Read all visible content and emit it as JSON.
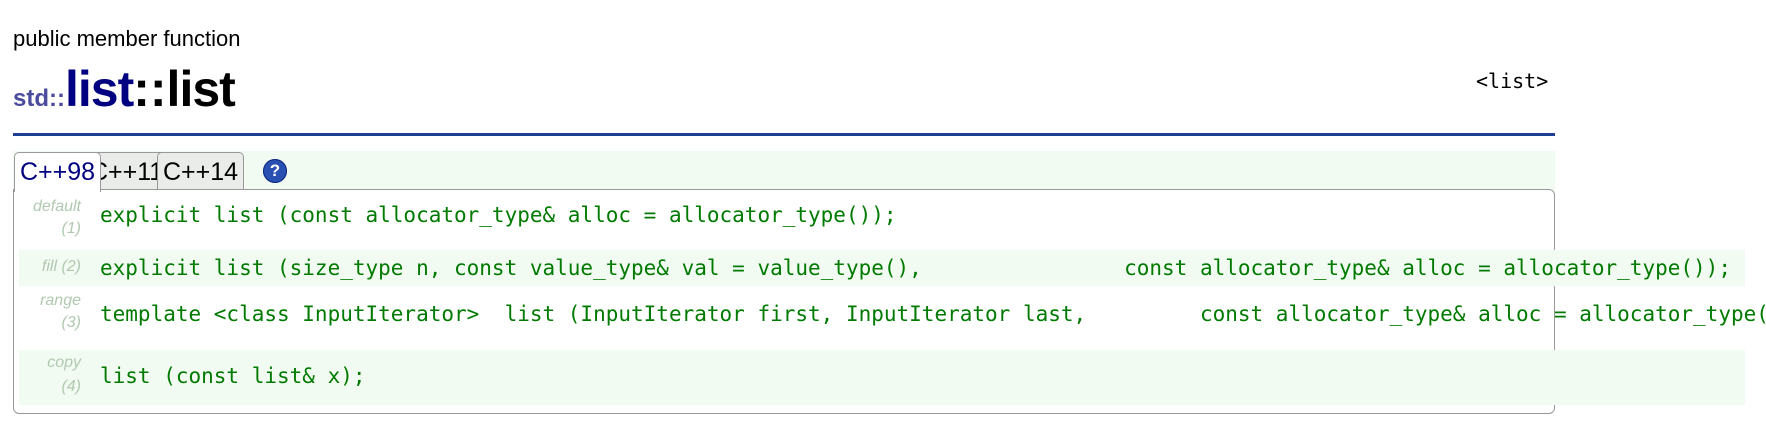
{
  "header": {
    "kind": "public member function",
    "namespace": "std::",
    "class_name": "list",
    "separator": "::",
    "function_name": "list",
    "include_tag": "<list>"
  },
  "tabs": [
    {
      "label": "C++98",
      "active": true
    },
    {
      "label": "C++11",
      "active": false
    },
    {
      "label": "C++14",
      "active": false
    }
  ],
  "help_icon": "?",
  "overloads": [
    {
      "label_top": "default",
      "label_bottom": "(1)",
      "code": "explicit list (const allocator_type& alloc = allocator_type());"
    },
    {
      "label_top": "fill (2)",
      "label_bottom": "",
      "code": "explicit list (size_type n, const value_type& val = value_type(),                const allocator_type& alloc = allocator_type());"
    },
    {
      "label_top": "range",
      "label_bottom": "(3)",
      "code": "template <class InputIterator>  list (InputIterator first, InputIterator last,         const allocator_type& alloc = allocator_type());"
    },
    {
      "label_top": "copy",
      "label_bottom": "(4)",
      "code": "list (const list& x);"
    }
  ],
  "colors": {
    "accent_rule": "#1e3e94",
    "namespace": "#4b4b9e",
    "class_name": "#000080",
    "code": "#007a00",
    "row_shade": "#f2fbf2",
    "label": "#b0c8b0"
  }
}
